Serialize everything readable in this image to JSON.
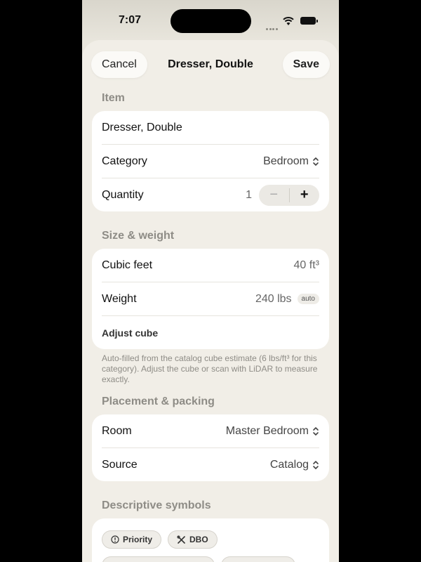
{
  "status": {
    "time": "7:07"
  },
  "nav": {
    "cancel": "Cancel",
    "title": "Dresser, Double",
    "save": "Save"
  },
  "item": {
    "section": "Item",
    "name": "Dresser, Double",
    "category_label": "Category",
    "category_value": "Bedroom",
    "quantity_label": "Quantity",
    "quantity_value": "1",
    "minus": "−",
    "plus": "+"
  },
  "size": {
    "section": "Size & weight",
    "cubic_label": "Cubic feet",
    "cubic_value": "40 ft³",
    "weight_label": "Weight",
    "weight_value": "240 lbs",
    "weight_badge": "auto",
    "adjust": "Adjust cube",
    "footnote": "Auto-filled from the catalog cube estimate (6 lbs/ft³ for this category). Adjust the cube or scan with LiDAR to measure exactly."
  },
  "placement": {
    "section": "Placement & packing",
    "room_label": "Room",
    "room_value": "Master Bedroom",
    "source_label": "Source",
    "source_value": "Catalog"
  },
  "symbols": {
    "section": "Descriptive symbols",
    "chips": [
      "Priority",
      "DBO"
    ]
  }
}
